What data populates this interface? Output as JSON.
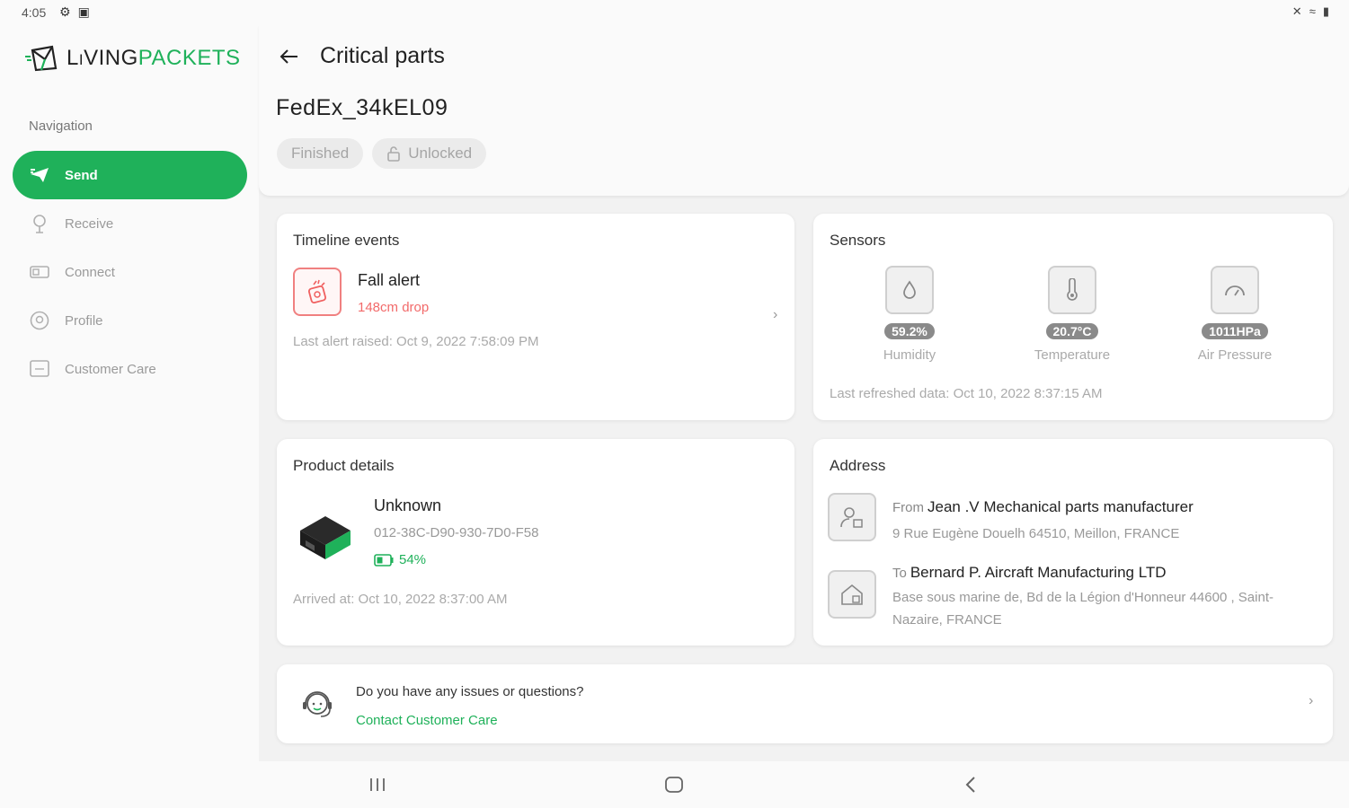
{
  "status_bar": {
    "time": "4:05"
  },
  "brand": {
    "name_part1": "LiVING",
    "name_part2": "PACKETS"
  },
  "sidebar": {
    "heading": "Navigation",
    "items": [
      {
        "label": "Send",
        "icon": "send-icon",
        "active": true
      },
      {
        "label": "Receive",
        "icon": "receive-icon",
        "active": false
      },
      {
        "label": "Connect",
        "icon": "connect-icon",
        "active": false
      },
      {
        "label": "Profile",
        "icon": "profile-icon",
        "active": false
      },
      {
        "label": "Customer Care",
        "icon": "customer-care-icon",
        "active": false
      }
    ]
  },
  "header": {
    "title": "Critical parts",
    "parcel_name": "FedEx_34kEL09",
    "chips": [
      {
        "label": "Finished"
      },
      {
        "label": "Unlocked",
        "icon": "unlock-icon"
      }
    ]
  },
  "timeline": {
    "title": "Timeline events",
    "event_title": "Fall alert",
    "event_detail": "148cm drop",
    "last_alert": "Last alert raised: Oct 9, 2022 7:58:09 PM"
  },
  "sensors": {
    "title": "Sensors",
    "items": [
      {
        "value": "59.2%",
        "label": "Humidity",
        "icon": "humidity-icon"
      },
      {
        "value": "20.7°C",
        "label": "Temperature",
        "icon": "thermometer-icon"
      },
      {
        "value": "1011HPa",
        "label": "Air Pressure",
        "icon": "pressure-gauge-icon"
      }
    ],
    "last_refreshed": "Last refreshed data: Oct 10, 2022 8:37:15 AM"
  },
  "product": {
    "title": "Product details",
    "name": "Unknown",
    "id": "012-38C-D90-930-7D0-F58",
    "battery": "54%",
    "arrived": "Arrived at: Oct 10, 2022 8:37:00 AM"
  },
  "address": {
    "title": "Address",
    "from_prefix": "From",
    "from_name": "Jean .V Mechanical parts manufacturer",
    "from_address": "9 Rue Eugène Douelh 64510, Meillon, FRANCE",
    "to_prefix": "To",
    "to_name": "Bernard P. Aircraft Manufacturing LTD",
    "to_address": "Base sous marine de, Bd de la Légion d'Honneur 44600 , Saint-Nazaire, FRANCE"
  },
  "help": {
    "question": "Do you have any issues or questions?",
    "link": "Contact Customer Care"
  },
  "colors": {
    "accent": "#1fb15a",
    "alert": "#f26a6a"
  }
}
